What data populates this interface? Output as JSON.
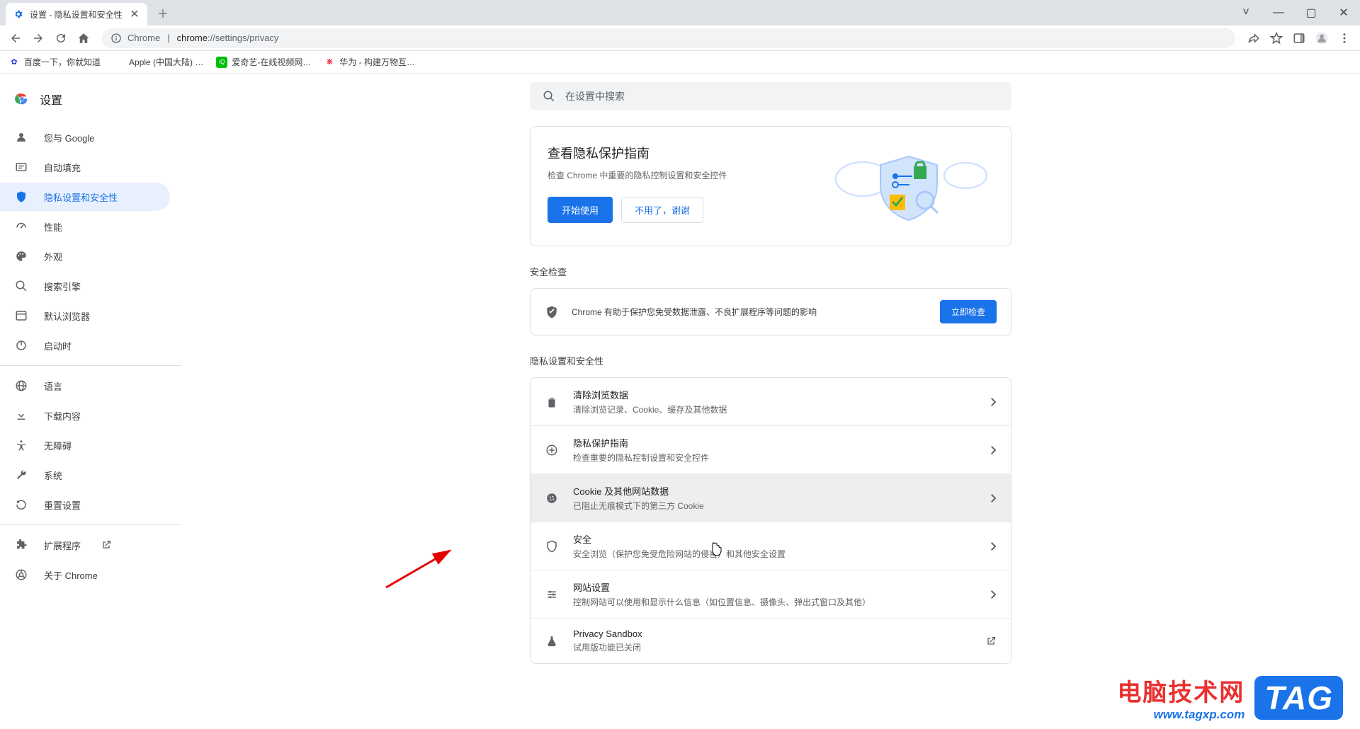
{
  "window": {
    "tab_title": "设置 - 隐私设置和安全性",
    "controls": {
      "min": "—",
      "max": "▢",
      "close": "✕",
      "chevron": "˅"
    }
  },
  "toolbar": {
    "url_prefix": "Chrome",
    "url_domain": "chrome",
    "url_path": "://settings/privacy"
  },
  "bookmarks": [
    {
      "label": "百度一下，你就知道"
    },
    {
      "label": "Apple (中国大陆) …"
    },
    {
      "label": "爱奇艺-在线视频网…"
    },
    {
      "label": "华为 - 构建万物互…"
    }
  ],
  "sidebar": {
    "title": "设置",
    "items": [
      {
        "label": "您与 Google",
        "icon": "person"
      },
      {
        "label": "自动填充",
        "icon": "autofill"
      },
      {
        "label": "隐私设置和安全性",
        "icon": "shield",
        "active": true
      },
      {
        "label": "性能",
        "icon": "speed"
      },
      {
        "label": "外观",
        "icon": "palette"
      },
      {
        "label": "搜索引擎",
        "icon": "search"
      },
      {
        "label": "默认浏览器",
        "icon": "browser"
      },
      {
        "label": "启动时",
        "icon": "power"
      }
    ],
    "items2": [
      {
        "label": "语言",
        "icon": "globe"
      },
      {
        "label": "下载内容",
        "icon": "download"
      },
      {
        "label": "无障碍",
        "icon": "accessibility"
      },
      {
        "label": "系统",
        "icon": "wrench"
      },
      {
        "label": "重置设置",
        "icon": "reset"
      }
    ],
    "items3": [
      {
        "label": "扩展程序",
        "icon": "extension",
        "ext": true
      },
      {
        "label": "关于 Chrome",
        "icon": "chrome"
      }
    ]
  },
  "search": {
    "placeholder": "在设置中搜索"
  },
  "guide": {
    "title": "查看隐私保护指南",
    "subtitle": "检查 Chrome 中重要的隐私控制设置和安全控件",
    "start": "开始使用",
    "dismiss": "不用了，谢谢"
  },
  "safety": {
    "heading": "安全检查",
    "text": "Chrome 有助于保护您免受数据泄露、不良扩展程序等问题的影响",
    "button": "立即检查"
  },
  "privacy": {
    "heading": "隐私设置和安全性",
    "rows": [
      {
        "title": "清除浏览数据",
        "sub": "清除浏览记录、Cookie、缓存及其他数据",
        "icon": "trash"
      },
      {
        "title": "隐私保护指南",
        "sub": "检查重要的隐私控制设置和安全控件",
        "icon": "guide"
      },
      {
        "title": "Cookie 及其他网站数据",
        "sub": "已阻止无痕模式下的第三方 Cookie",
        "icon": "cookie",
        "hover": true
      },
      {
        "title": "安全",
        "sub": "安全浏览（保护您免受危险网站的侵害）和其他安全设置",
        "icon": "safety"
      },
      {
        "title": "网站设置",
        "sub": "控制网站可以使用和显示什么信息（如位置信息、摄像头、弹出式窗口及其他）",
        "icon": "tune"
      },
      {
        "title": "Privacy Sandbox",
        "sub": "试用版功能已关闭",
        "icon": "flask",
        "external": true
      }
    ]
  },
  "watermark": {
    "cn": "电脑技术网",
    "url": "www.tagxp.com",
    "tag": "TAG"
  }
}
